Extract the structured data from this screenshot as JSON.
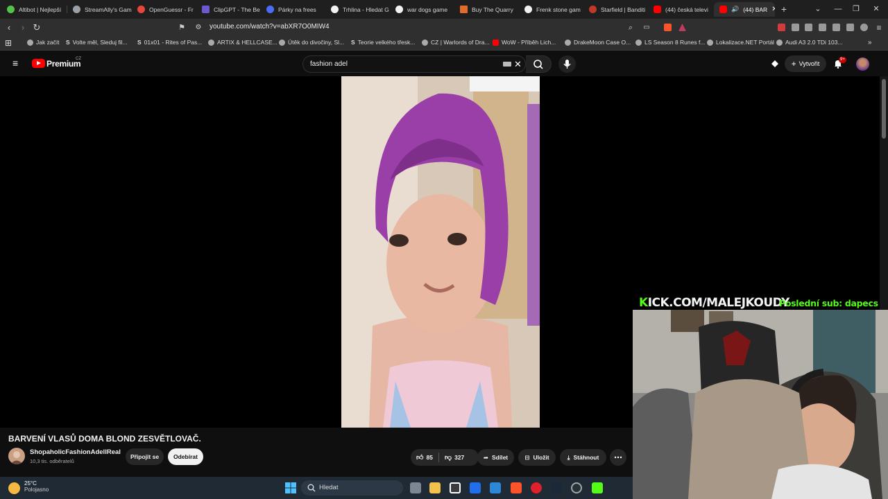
{
  "browser": {
    "tabs": [
      {
        "label": "Altibot | Nejlepší",
        "color": "#53c24a"
      },
      {
        "label": "StreamAlly's Gam",
        "color": "#9aa0a6"
      },
      {
        "label": "OpenGuessr - Fr",
        "color": "#e8453c"
      },
      {
        "label": "ClipGPT - The Be",
        "color": "#6a5acd"
      },
      {
        "label": "Párky na frees",
        "color": "#4a6cf7"
      },
      {
        "label": "Trhlina - Hledat G",
        "color": "#f2f2f2"
      },
      {
        "label": "war dogs game",
        "color": "#f2f2f2"
      },
      {
        "label": "Buy The Quarry",
        "color": "#e06b2c"
      },
      {
        "label": "Frenk stone gam",
        "color": "#f2f2f2"
      },
      {
        "label": "Starfield | Banditi",
        "color": "#c0392b"
      },
      {
        "label": "(44) česká televi",
        "color": "#ff0000"
      },
      {
        "label": "(44) BAR",
        "color": "#ff0000"
      }
    ],
    "url": "youtube.com/watch?v=abXR7O0MIW4",
    "bookmarks": [
      {
        "label": "Jak začít",
        "icon": "globe-icon"
      },
      {
        "label": "Volte měl, Sleduj fil...",
        "icon": "s-icon"
      },
      {
        "label": "01x01 - Rites of Pas...",
        "icon": "s-icon"
      },
      {
        "label": "ARTIX & HELLCASE...",
        "icon": "globe-icon"
      },
      {
        "label": "Útěk do divočiny, Sl...",
        "icon": "globe-icon"
      },
      {
        "label": "Teorie velkého třesk...",
        "icon": "s-icon"
      },
      {
        "label": "CZ | Warlords of Dra...",
        "icon": "globe-icon"
      },
      {
        "label": "WoW - Příběh Lich...",
        "icon": "youtube-icon"
      },
      {
        "label": "DrakeMoon Case O...",
        "icon": "globe-icon"
      },
      {
        "label": "LS Season 8 Runes f...",
        "icon": "globe-icon"
      },
      {
        "label": "Lokalizace.NET Portál",
        "icon": "globe-icon"
      },
      {
        "label": "Audi A3 2.0 TDi 103...",
        "icon": "globe-icon"
      }
    ],
    "notif_badge": "9+"
  },
  "youtube": {
    "logo_text": "Premium",
    "region": "CZ",
    "search_value": "fashion adel",
    "create_label": "Vytvořit",
    "video_title": "BARVENÍ VLASŮ DOMA BLOND ZESVĚTLOVAČ.",
    "channel_name": "ShopaholicFashionAdellReal",
    "subscribers": "10,3 tis. odběratelů",
    "join_label": "Připojit se",
    "subscribe_label": "Odebírat",
    "likes": "85",
    "dislikes": "327",
    "share_label": "Sdílet",
    "save_label": "Uložit",
    "download_label": "Stáhnout"
  },
  "overlay": {
    "kick_prefix": "K",
    "kick_rest": "ICK.COM/MALEJKOUDY",
    "last_sub": "Poslední sub: dapecs"
  },
  "taskbar": {
    "temp": "25°C",
    "weather": "Polojasno",
    "search_label": "Hledat"
  },
  "colors": {
    "accent_red": "#ff0000",
    "kick_green": "#53fc18"
  }
}
